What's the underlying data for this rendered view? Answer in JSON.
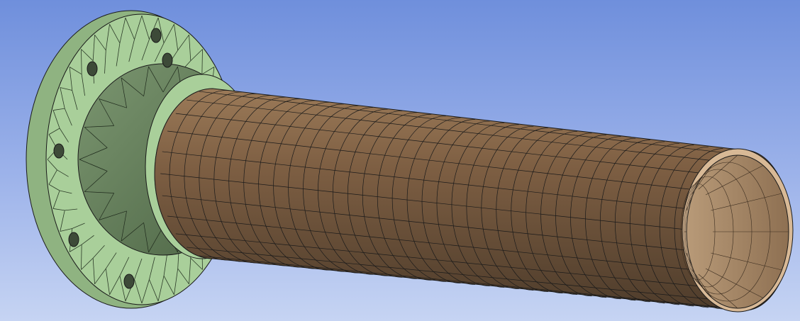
{
  "viewport": {
    "background_top": "#6f8fdc",
    "background_bottom": "#c6d4f3"
  },
  "model": {
    "bodies": [
      {
        "id": "flange",
        "fill_color": "#a9cf9a",
        "hub_color": "#5f7a55",
        "mesh_type": "triangular",
        "bolt_holes": 6,
        "bolt_hole_icon": "bolt-hole-icon"
      },
      {
        "id": "pipe",
        "fill_color": "#8a6a4b",
        "rim_color": "#d8b996",
        "mesh_type": "quadrilateral"
      }
    ],
    "mesh_line_color": "#1a1a1a"
  }
}
